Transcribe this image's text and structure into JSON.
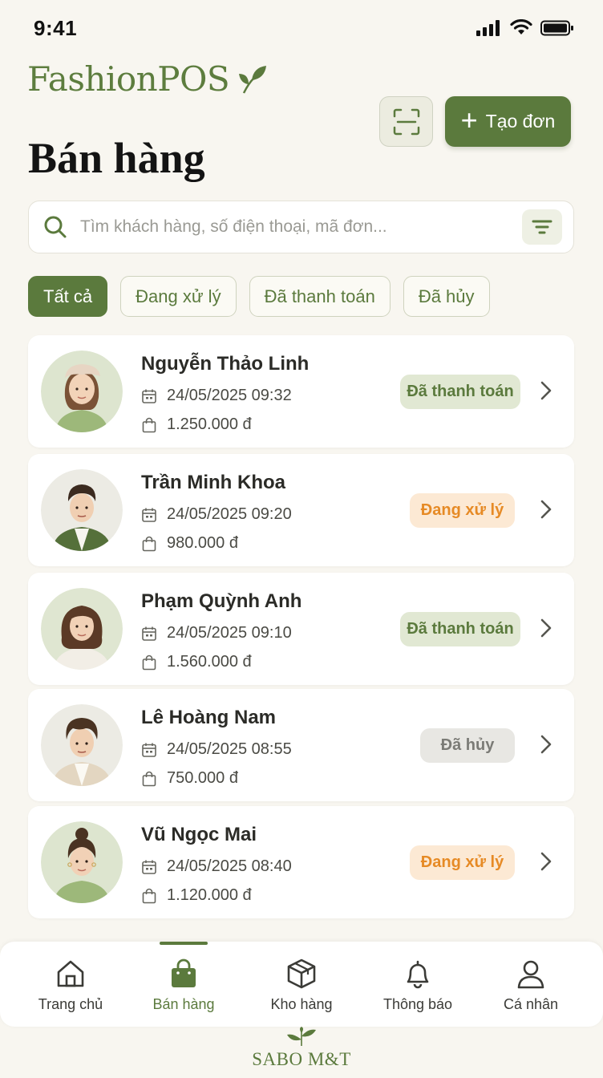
{
  "status_bar": {
    "time": "9:41"
  },
  "brand": {
    "name": "FashionPOS",
    "logo_icon": "leaf-icon"
  },
  "header": {
    "title": "Bán hàng",
    "scan_icon": "scan-icon",
    "create_label": "Tạo đơn"
  },
  "search": {
    "placeholder": "Tìm khách hàng, số điện thoại, mã đơn...",
    "search_icon": "search-icon",
    "filter_icon": "filter-icon"
  },
  "tabs": [
    {
      "label": "Tất cả",
      "active": true
    },
    {
      "label": "Đang xử lý",
      "active": false
    },
    {
      "label": "Đã thanh toán",
      "active": false
    },
    {
      "label": "Đã hủy",
      "active": false
    }
  ],
  "orders": [
    {
      "name": "Nguyễn Thảo Linh",
      "datetime": "24/05/2025 09:32",
      "amount": "1.250.000 đ",
      "status": "Đã thanh toán",
      "status_type": "paid"
    },
    {
      "name": "Trần Minh Khoa",
      "datetime": "24/05/2025 09:20",
      "amount": "980.000 đ",
      "status": "Đang xử lý",
      "status_type": "processing"
    },
    {
      "name": "Phạm Quỳnh Anh",
      "datetime": "24/05/2025 09:10",
      "amount": "1.560.000 đ",
      "status": "Đã thanh toán",
      "status_type": "paid"
    },
    {
      "name": "Lê Hoàng Nam",
      "datetime": "24/05/2025 08:55",
      "amount": "750.000 đ",
      "status": "Đã hủy",
      "status_type": "cancelled"
    },
    {
      "name": "Vũ Ngọc Mai",
      "datetime": "24/05/2025 08:40",
      "amount": "1.120.000 đ",
      "status": "Đang xử lý",
      "status_type": "processing"
    }
  ],
  "bottom_nav": [
    {
      "label": "Trang chủ",
      "icon": "home-icon",
      "active": false
    },
    {
      "label": "Bán hàng",
      "icon": "shopping-bag-icon",
      "active": true
    },
    {
      "label": "Kho hàng",
      "icon": "box-icon",
      "active": false
    },
    {
      "label": "Thông báo",
      "icon": "bell-icon",
      "active": false
    },
    {
      "label": "Cá nhân",
      "icon": "user-icon",
      "active": false
    }
  ],
  "footer": {
    "brand": "SABO M&T"
  },
  "colors": {
    "primary": "#5b7a3d",
    "background": "#f8f6f0",
    "paid_bg": "#e1e8d3",
    "processing_bg": "#fce9d4",
    "processing_text": "#e68a25",
    "cancelled_bg": "#e8e7e3"
  }
}
